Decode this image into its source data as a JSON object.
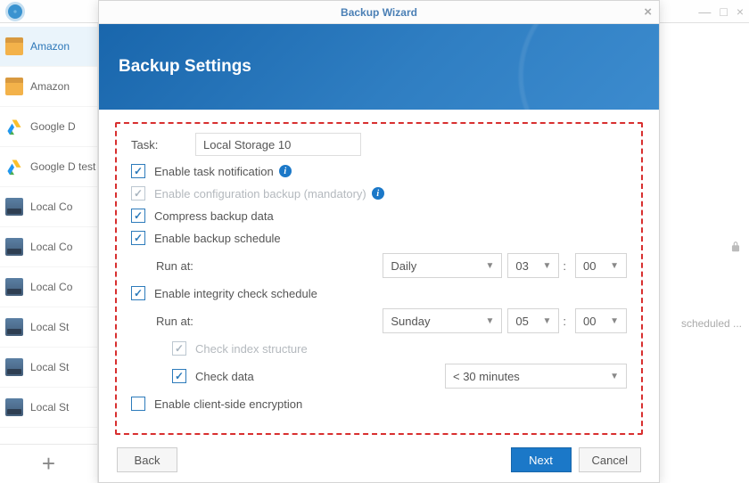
{
  "window": {
    "min": "—",
    "max": "□",
    "close": "×"
  },
  "sidebar": {
    "items": [
      {
        "label": "Amazon"
      },
      {
        "label": "Amazon"
      },
      {
        "label": "Google D"
      },
      {
        "label": "Google D test"
      },
      {
        "label": "Local Co"
      },
      {
        "label": "Local Co"
      },
      {
        "label": "Local Co"
      },
      {
        "label": "Local St"
      },
      {
        "label": "Local St"
      },
      {
        "label": "Local St"
      }
    ],
    "add": "+"
  },
  "bg": {
    "scheduled": "scheduled ..."
  },
  "modal": {
    "title": "Backup Wizard",
    "banner": "Backup Settings",
    "close": "×",
    "task_label": "Task:",
    "task_value": "Local Storage 10",
    "opt_notify": "Enable task notification",
    "opt_config": "Enable configuration backup (mandatory)",
    "opt_compress": "Compress backup data",
    "opt_backup_sched": "Enable backup schedule",
    "runat": "Run at:",
    "freq_backup": "Daily",
    "hour_backup": "03",
    "min_backup": "00",
    "opt_integrity": "Enable integrity check schedule",
    "freq_integrity": "Sunday",
    "hour_integrity": "05",
    "min_integrity": "00",
    "check_index": "Check index structure",
    "check_data": "Check data",
    "duration": "< 30 minutes",
    "opt_encryption": "Enable client-side encryption",
    "info": "i",
    "btn_back": "Back",
    "btn_next": "Next",
    "btn_cancel": "Cancel"
  }
}
